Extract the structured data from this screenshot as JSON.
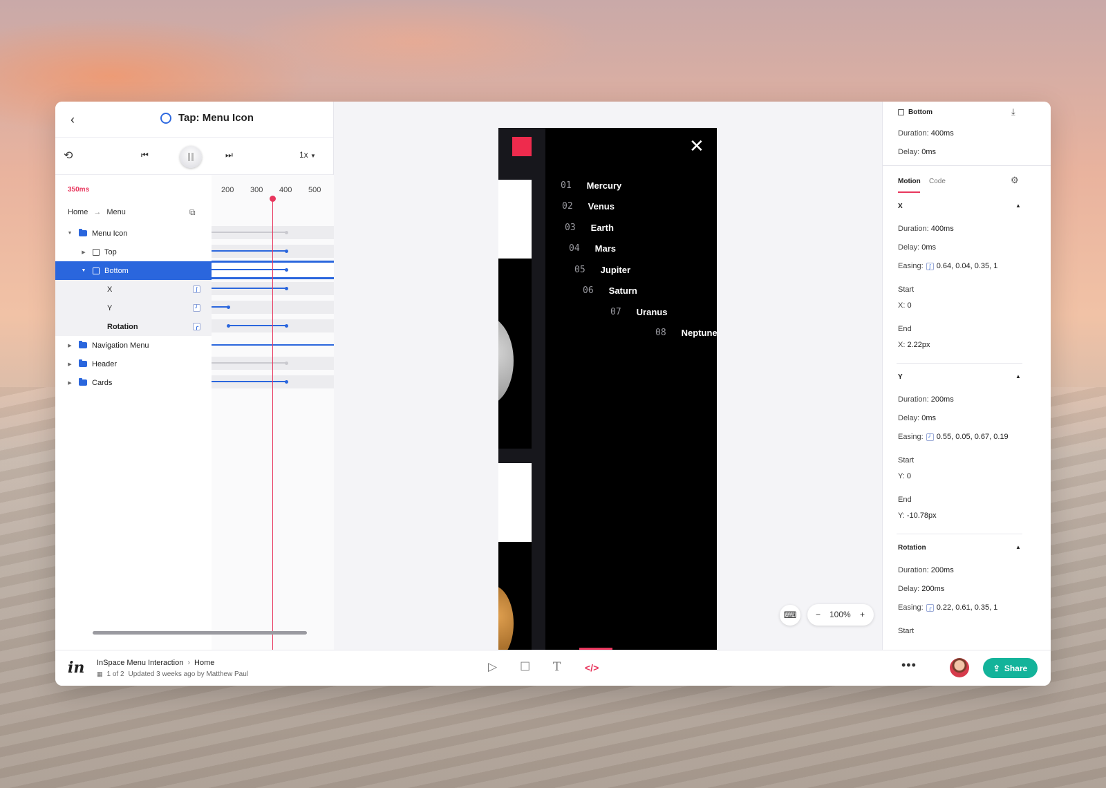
{
  "header": {
    "back_icon": "chevron-left-icon",
    "title": "Tap: Menu Icon"
  },
  "controls": {
    "speed": "1x"
  },
  "timeline": {
    "current_time": "350ms",
    "ticks": [
      "200",
      "300",
      "400",
      "500"
    ],
    "current_ms": 350
  },
  "breadcrumb": {
    "from": "Home",
    "to": "Menu"
  },
  "layers": [
    {
      "label": "Menu Icon",
      "type": "folder",
      "expanded": true
    },
    {
      "label": "Top",
      "type": "square",
      "expanded": false
    },
    {
      "label": "Bottom",
      "type": "square",
      "expanded": true,
      "selected": true
    },
    {
      "label": "X",
      "type": "property"
    },
    {
      "label": "Y",
      "type": "property"
    },
    {
      "label": "Rotation",
      "type": "property"
    },
    {
      "label": "Navigation Menu",
      "type": "folder",
      "expanded": false
    },
    {
      "label": "Header",
      "type": "folder",
      "expanded": false
    },
    {
      "label": "Cards",
      "type": "folder",
      "expanded": false
    }
  ],
  "phone": {
    "planets": [
      {
        "num": "01",
        "name": "Mercury"
      },
      {
        "num": "02",
        "name": "Venus"
      },
      {
        "num": "03",
        "name": "Earth"
      },
      {
        "num": "04",
        "name": "Mars"
      },
      {
        "num": "05",
        "name": "Jupiter"
      },
      {
        "num": "06",
        "name": "Saturn"
      },
      {
        "num": "07",
        "name": "Uranus"
      },
      {
        "num": "08",
        "name": "Neptune"
      }
    ],
    "accent": "#ee2b4d"
  },
  "zoom": {
    "minus": "−",
    "value": "100%",
    "plus": "+"
  },
  "inspector": {
    "layer_name": "Bottom",
    "duration_label": "Duration:",
    "delay_label": "Delay:",
    "easing_label": "Easing:",
    "start_label": "Start",
    "end_label": "End",
    "duration": "400ms",
    "delay": "0ms",
    "tabs": {
      "motion": "Motion",
      "code": "Code"
    },
    "x": {
      "title": "X",
      "duration": "400ms",
      "delay": "0ms",
      "easing": "0.64, 0.04, 0.35, 1",
      "start_key": "X:",
      "start": "0",
      "end_key": "X:",
      "end": "2.22px"
    },
    "y": {
      "title": "Y",
      "duration": "200ms",
      "delay": "0ms",
      "easing": "0.55, 0.05, 0.67, 0.19",
      "start_key": "Y:",
      "start": "0",
      "end_key": "Y:",
      "end": "-10.78px"
    },
    "rotation": {
      "title": "Rotation",
      "duration": "200ms",
      "delay": "200ms",
      "easing": "0.22, 0.61, 0.35, 1"
    }
  },
  "footer": {
    "project": "InSpace Menu Interaction",
    "screen": "Home",
    "page_count": "1 of 2",
    "updated": "Updated 3 weeks ago by Matthew Paul",
    "share": "Share",
    "logo": "in"
  },
  "colors": {
    "accent_blue": "#2a66dd",
    "accent_red": "#e8365d",
    "share_green": "#13b39a"
  }
}
